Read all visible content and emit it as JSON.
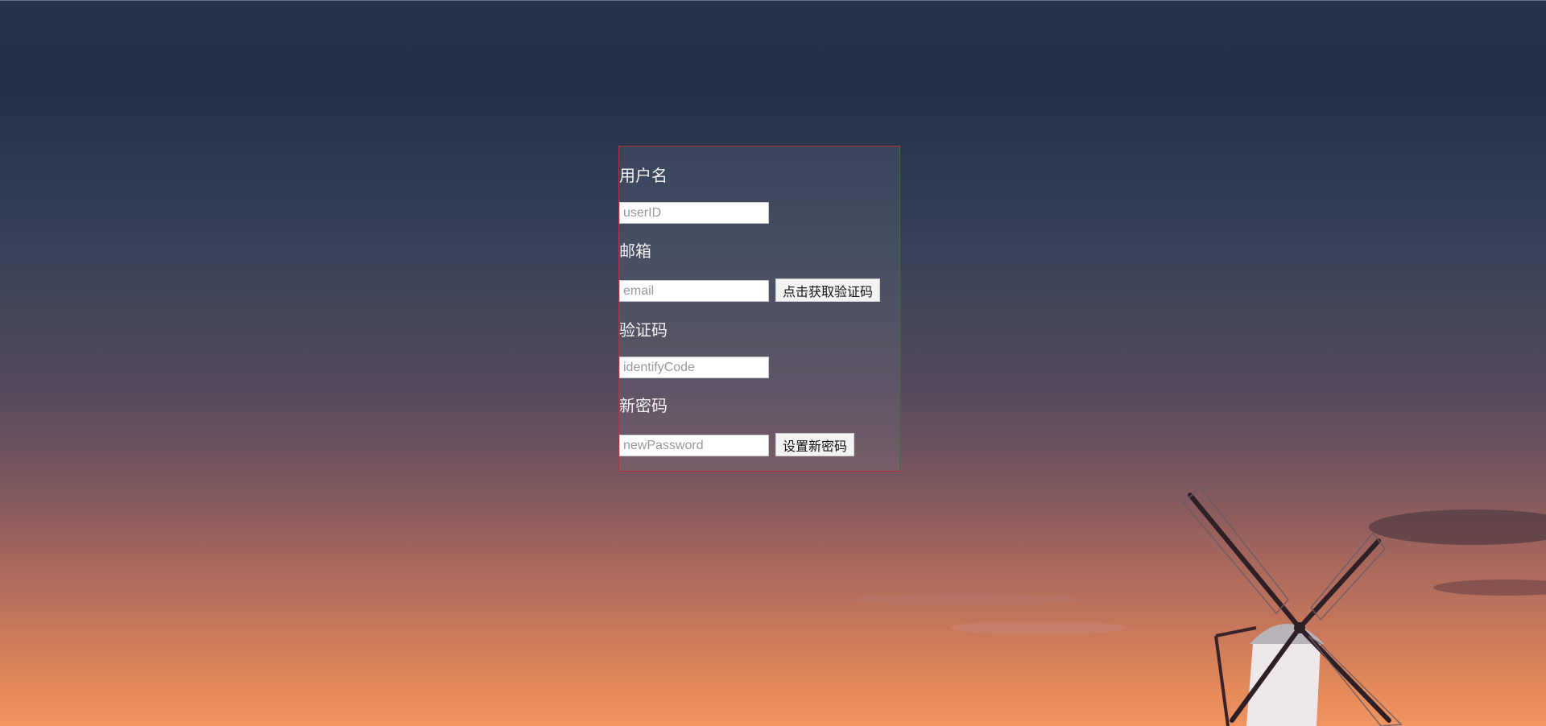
{
  "form": {
    "username": {
      "label": "用户名",
      "placeholder": "userID"
    },
    "email": {
      "label": "邮箱",
      "placeholder": "email",
      "send_code_button": "点击获取验证码"
    },
    "code": {
      "label": "验证码",
      "placeholder": "identifyCode"
    },
    "new_password": {
      "label": "新密码",
      "placeholder": "newPassword",
      "submit_button": "设置新密码"
    }
  },
  "colors": {
    "panel_border": "#b2333f",
    "sky_top": "#263349",
    "sky_bottom": "#ef9560"
  }
}
